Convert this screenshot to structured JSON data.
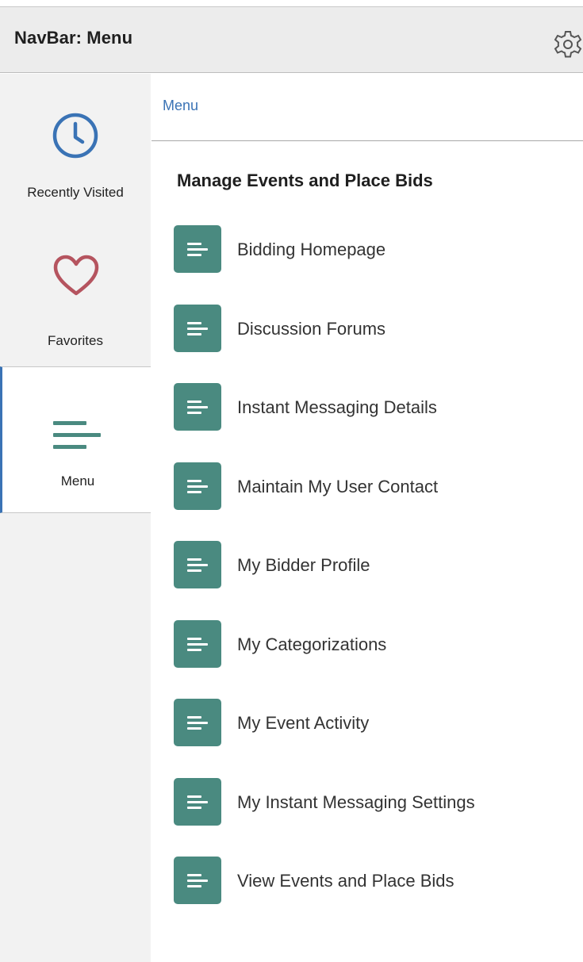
{
  "header": {
    "title": "NavBar: Menu",
    "settings_icon": "gear-icon"
  },
  "sidebar": {
    "items": [
      {
        "label": "Recently Visited",
        "icon": "clock-icon",
        "active": false
      },
      {
        "label": "Favorites",
        "icon": "heart-icon",
        "active": false
      },
      {
        "label": "Menu",
        "icon": "menu-lines-icon",
        "active": true
      }
    ]
  },
  "content": {
    "breadcrumb": "Menu",
    "section_title": "Manage Events and Place Bids",
    "items": [
      {
        "label": "Bidding Homepage",
        "icon": "document-lines-icon"
      },
      {
        "label": "Discussion Forums",
        "icon": "document-lines-icon"
      },
      {
        "label": "Instant Messaging Details",
        "icon": "document-lines-icon"
      },
      {
        "label": "Maintain My User Contact",
        "icon": "document-lines-icon"
      },
      {
        "label": "My Bidder Profile",
        "icon": "document-lines-icon"
      },
      {
        "label": "My Categorizations",
        "icon": "document-lines-icon"
      },
      {
        "label": "My Event Activity",
        "icon": "document-lines-icon"
      },
      {
        "label": "My Instant Messaging Settings",
        "icon": "document-lines-icon"
      },
      {
        "label": "View Events and Place Bids",
        "icon": "document-lines-icon"
      }
    ]
  },
  "colors": {
    "accent_blue": "#3a73b5",
    "tile_teal": "#4a8a80",
    "heart": "#b5545f",
    "header_bg": "#ececec",
    "sidebar_bg": "#f2f2f2"
  }
}
